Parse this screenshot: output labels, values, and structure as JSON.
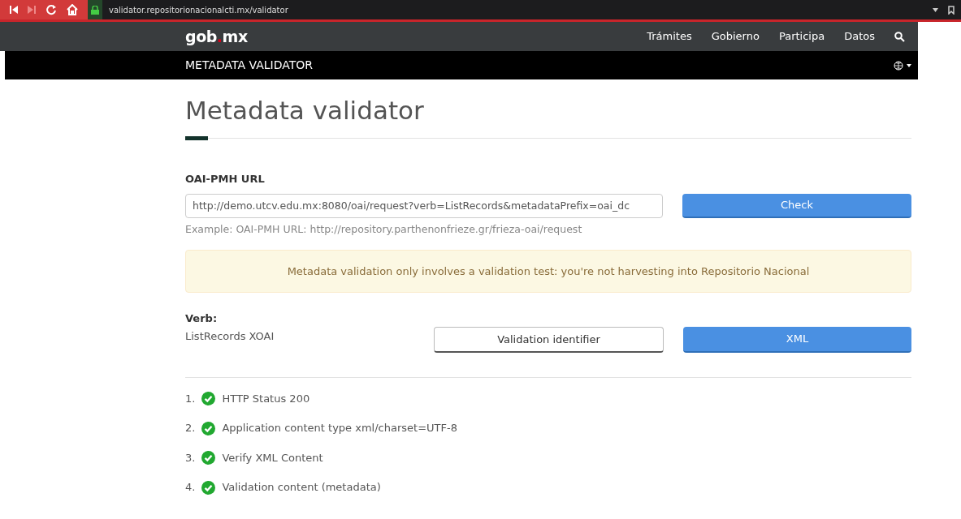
{
  "browser": {
    "url": "validator.repositorionacionalcti.mx/validator"
  },
  "nav": {
    "logo": {
      "before": "gob",
      "dot": ".",
      "after": "mx"
    },
    "links": [
      "Trámites",
      "Gobierno",
      "Participa",
      "Datos"
    ]
  },
  "subnav": {
    "title": "METADATA VALIDATOR"
  },
  "page": {
    "heading": "Metadata validator"
  },
  "form": {
    "label": "OAI-PMH URL",
    "value": "http://demo.utcv.edu.mx:8080/oai/request?verb=ListRecords&metadataPrefix=oai_dc",
    "button": "Check",
    "example": "Example: OAI-PMH URL: http://repository.parthenonfrieze.gr/frieza-oai/request"
  },
  "alert": "Metadata validation only involves a validation test: you're not harvesting into Repositorio Nacional",
  "verb": {
    "label": "Verb:",
    "value": "ListRecords XOAI",
    "buttons": [
      {
        "label": "Validation identifier",
        "kind": "outline"
      },
      {
        "label": "XML",
        "kind": "primary"
      }
    ]
  },
  "checks": [
    {
      "number": "1.",
      "label": "HTTP Status 200",
      "passed": true
    },
    {
      "number": "2.",
      "label": "Application content type xml/charset=UTF-8",
      "passed": true
    },
    {
      "number": "3.",
      "label": "Verify XML Content",
      "passed": true
    },
    {
      "number": "4.",
      "label": "Validation content (metadata)",
      "passed": true
    }
  ]
}
